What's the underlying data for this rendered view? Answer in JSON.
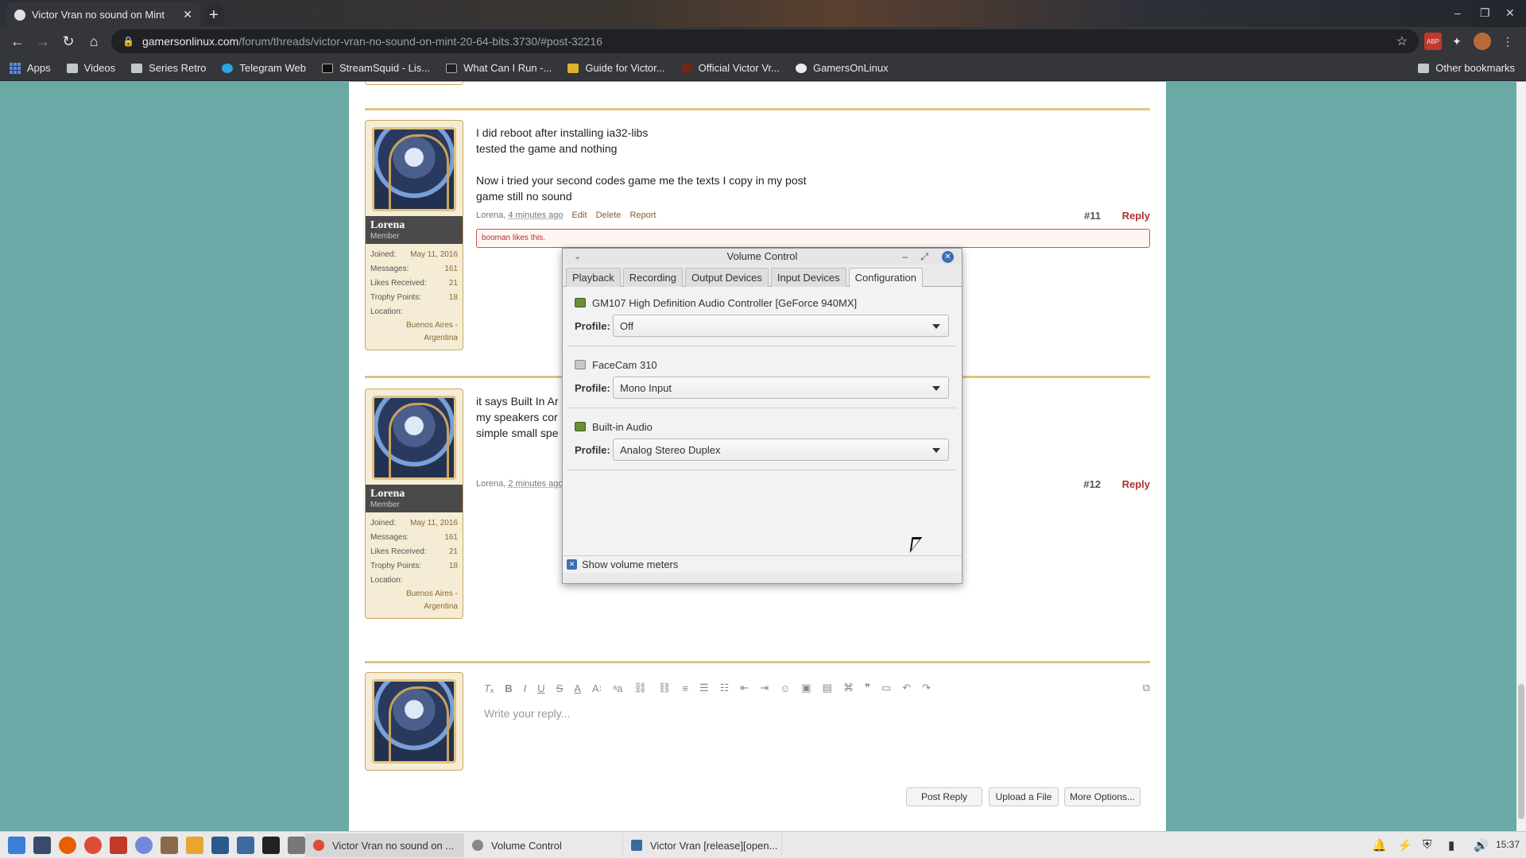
{
  "browser": {
    "tab_title": "Victor Vran no sound on Mint",
    "url_host": "gamersonlinux.com",
    "url_path": "/forum/threads/victor-vran-no-sound-on-mint-20-64-bits.3730/#post-32216",
    "bookmarks": [
      "Apps",
      "Videos",
      "Series Retro",
      "Telegram Web",
      "StreamSquid - Lis...",
      "What Can I Run -...",
      "Guide for Victor...",
      "Official Victor Vr...",
      "GamersOnLinux"
    ],
    "other_bookmarks": "Other bookmarks"
  },
  "posts": [
    {
      "user": "Lorena",
      "rank": "Member",
      "joined_label": "Joined:",
      "joined": "May 11, 2016",
      "messages_label": "Messages:",
      "messages": "161",
      "likes_label": "Likes Received:",
      "likes": "21",
      "trophy_label": "Trophy Points:",
      "trophy": "18",
      "location_label": "Location:",
      "location": "Buenos Aires - Argentina",
      "lines": [
        "I did reboot after installing ia32-libs",
        "tested the game and nothing",
        "",
        "Now i tried your second codes game me the texts I copy in my post",
        "game still no sound"
      ],
      "meta_author": "Lorena,",
      "meta_time": "4 minutes ago",
      "edit": "Edit",
      "delete": "Delete",
      "report": "Report",
      "number": "#11",
      "reply": "Reply",
      "likes_bar": "booman likes this."
    },
    {
      "user": "Lorena",
      "rank": "Member",
      "joined_label": "Joined:",
      "joined": "May 11, 2016",
      "messages_label": "Messages:",
      "messages": "161",
      "likes_label": "Likes Received:",
      "likes": "21",
      "trophy_label": "Trophy Points:",
      "trophy": "18",
      "location_label": "Location:",
      "location": "Buenos Aires - Argentina",
      "lines": [
        "it says Built In Ar",
        "my speakers cor",
        "simple small spe"
      ],
      "meta_author": "Lorena,",
      "meta_time": "2 minutes ago",
      "number": "#12",
      "reply": "Reply"
    }
  ],
  "editor": {
    "placeholder": "Write your reply...",
    "post_reply": "Post Reply",
    "upload": "Upload a File",
    "more": "More Options..."
  },
  "volume_control": {
    "title": "Volume Control",
    "tabs": [
      "Playback",
      "Recording",
      "Output Devices",
      "Input Devices",
      "Configuration"
    ],
    "active_tab": "Configuration",
    "profile_label": "Profile:",
    "cards": [
      {
        "name": "GM107 High Definition Audio Controller [GeForce 940MX]",
        "profile": "Off"
      },
      {
        "name": "FaceCam 310",
        "profile": "Mono Input"
      },
      {
        "name": "Built-in Audio",
        "profile": "Analog Stereo Duplex"
      }
    ],
    "show_meters": "Show volume meters",
    "show_meters_checked": true
  },
  "taskbar": {
    "tasks": [
      "Victor Vran no sound on ...",
      "Volume Control",
      "Victor Vran [release][open..."
    ],
    "clock": "15:37"
  }
}
